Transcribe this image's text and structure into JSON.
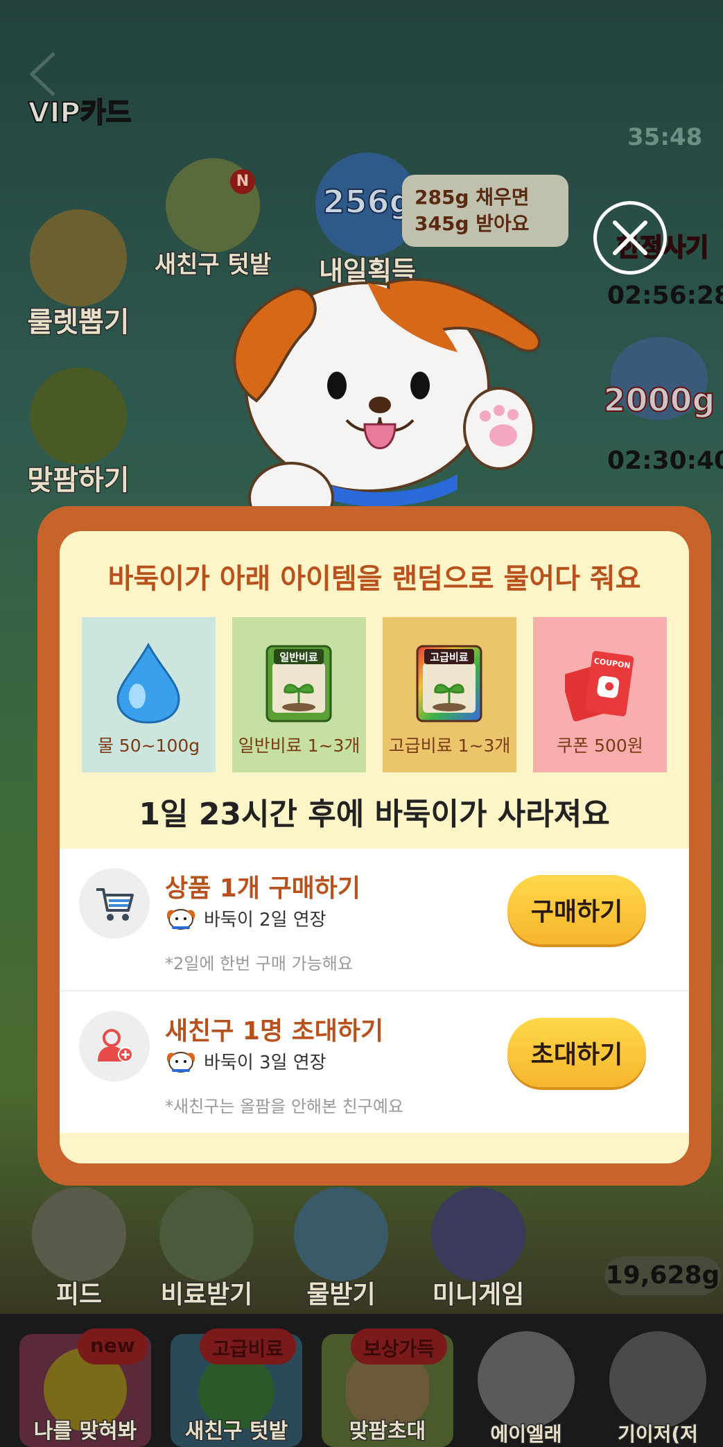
{
  "background": {
    "top_timer": "35:48",
    "vip_label": "VIP카드",
    "new_friend_field_label": "새친구 텃밭",
    "new_friend_badge": "N",
    "tomorrow_label": "내일획득",
    "tomorrow_amount": "256g",
    "fertilizer_line1": "285g 채우면",
    "fertilizer_line2": "345g 받아요",
    "roulette_label": "룰렛뽑기",
    "matpam_label": "맞팜하기",
    "right_badge_text": "한정사기",
    "right_timer_1": "02:56:28",
    "right_amount": "2000g",
    "right_timer_2": "02:30:40",
    "bottom_feed": "피드",
    "bottom_fertilizer": "비료받기",
    "bottom_water": "물받기",
    "bottom_minigame": "미니게임",
    "water_total": "19,628g",
    "tab_1": "나를 맞혀봐",
    "tab_1_badge": "new",
    "tab_2": "새친구 텃밭",
    "tab_2_badge": "고급비료",
    "tab_3": "맞팜초대",
    "tab_3_badge": "보상가득",
    "tab_4": "에이엘래",
    "tab_5": "기이저(저"
  },
  "modal": {
    "title": "바둑이가 아래 아이템을 랜덤으로 물어다 줘요",
    "items": [
      {
        "label": "물 50~100g",
        "icon": "water-drop-icon",
        "bg": "#cce6df"
      },
      {
        "label": "일반비료 1~3개",
        "icon": "basic-fertilizer-icon",
        "bg": "#c5e0a0",
        "pack_text": "일반비료"
      },
      {
        "label": "고급비료 1~3개",
        "icon": "premium-fertilizer-icon",
        "bg": "#ebc56c",
        "pack_text": "고급비료"
      },
      {
        "label": "쿠폰  500원",
        "icon": "coupon-icon",
        "bg": "#f8aeae",
        "coupon_text": "COUPON"
      }
    ],
    "vanish_text": "1일 23시간 후에 바둑이가 사라져요",
    "tasks": [
      {
        "title": "상품 1개 구매하기",
        "subtitle": "바둑이 2일 연장",
        "note": "*2일에 한번 구매 가능해요",
        "button": "구매하기"
      },
      {
        "title": "새친구 1명 초대하기",
        "subtitle": "바둑이 3일 연장",
        "note": "*새친구는 올팜을 안해본 친구예요",
        "button": "초대하기"
      }
    ]
  },
  "colors": {
    "frame": "#c8632c",
    "panel": "#fdf4c8",
    "title": "#b8511b",
    "button": "#f6b52c"
  }
}
